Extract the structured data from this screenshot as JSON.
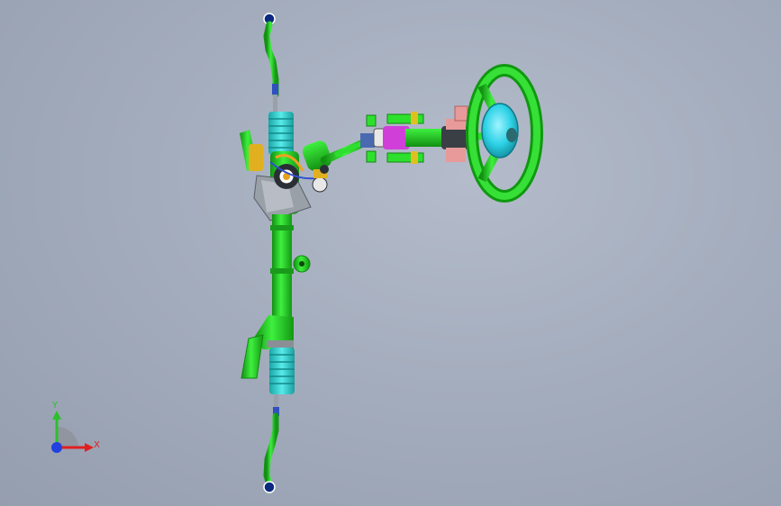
{
  "viewport": {
    "background_top": "#b4bccb",
    "background_bottom": "#959eaf"
  },
  "model": {
    "assembly": "steering-system",
    "colors": {
      "body_green": "#2ee02e",
      "dark_green": "#149814",
      "boot_cyan": "#38d8d8",
      "airbag_cyan": "#3ad6e8",
      "magenta": "#d040d8",
      "orange": "#f0a020",
      "salmon": "#e89a9a",
      "gray": "#8a8f96",
      "steel": "#4a6ab0"
    }
  },
  "triad": {
    "y_label": "Y",
    "x_label": "X",
    "y_color": "#2cc02c",
    "x_color": "#e02020",
    "z_color": "#2040e0"
  }
}
